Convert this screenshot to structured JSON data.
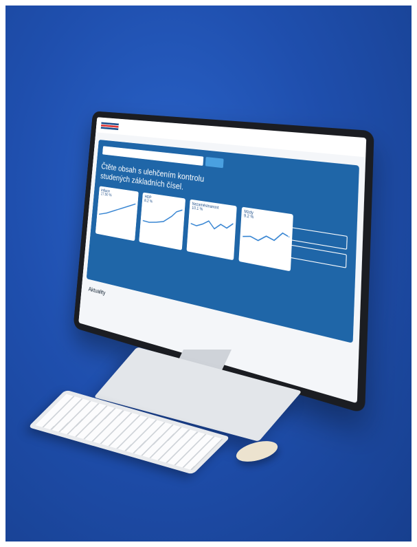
{
  "scene": {
    "description_colors": {
      "background": "#1f4fae",
      "screen_accent": "#1f66a8"
    }
  },
  "screen": {
    "hero_title": "Čtěte obsah s ulehčením kontrolu studených základních čísel.",
    "cards": [
      {
        "title": "Inflace",
        "value": "17.50 %"
      },
      {
        "title": "HDP",
        "value": "8.2 %"
      },
      {
        "title": "Nezaměstnanost",
        "value": "10.1 %"
      },
      {
        "title": "Mzdy",
        "value": "9.2 %"
      }
    ],
    "section_heading": "Aktuality"
  }
}
